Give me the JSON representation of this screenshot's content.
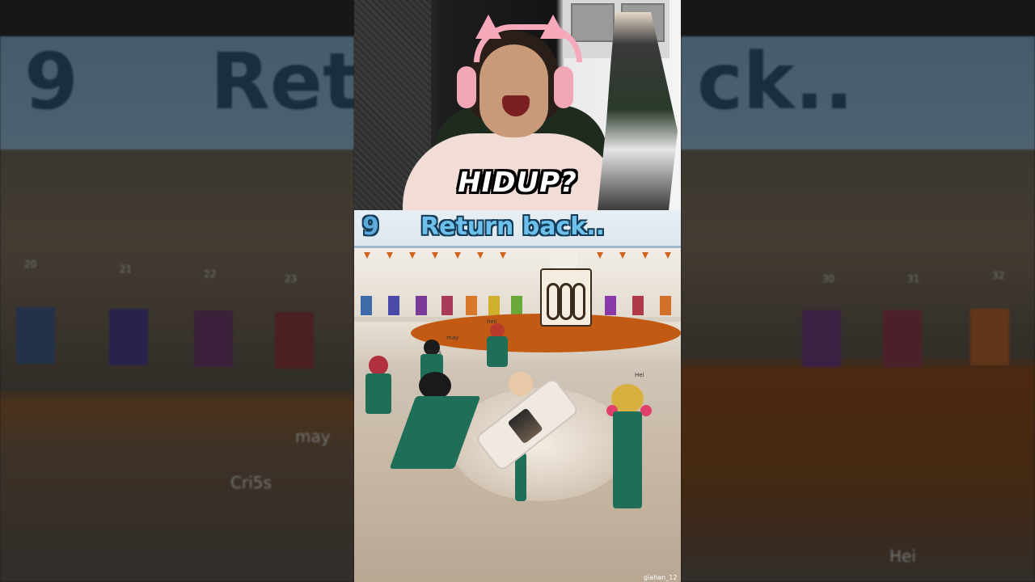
{
  "webcam": {
    "caption": "HIDUP?"
  },
  "game": {
    "stage_number": "9",
    "stage_title": "Return back..",
    "player_tags": [
      "may",
      "Cri5s",
      "heil",
      "Hei"
    ],
    "bottom_tag": "giahan_12"
  },
  "background": {
    "left_number": "9",
    "left_partial_title": "Ret",
    "right_partial_title": "ck..",
    "left_tags": [
      "may",
      "Cri5s"
    ],
    "right_tag": "Hei",
    "left_door_numbers": [
      "20",
      "21",
      "22",
      "23"
    ],
    "right_door_numbers": [
      "30",
      "31",
      "32"
    ]
  },
  "colors": {
    "banner_text": "#6cc0ea",
    "banner_outline": "#123b58",
    "platform": "#c25a14",
    "avatar_suit": "#1f6e58"
  }
}
